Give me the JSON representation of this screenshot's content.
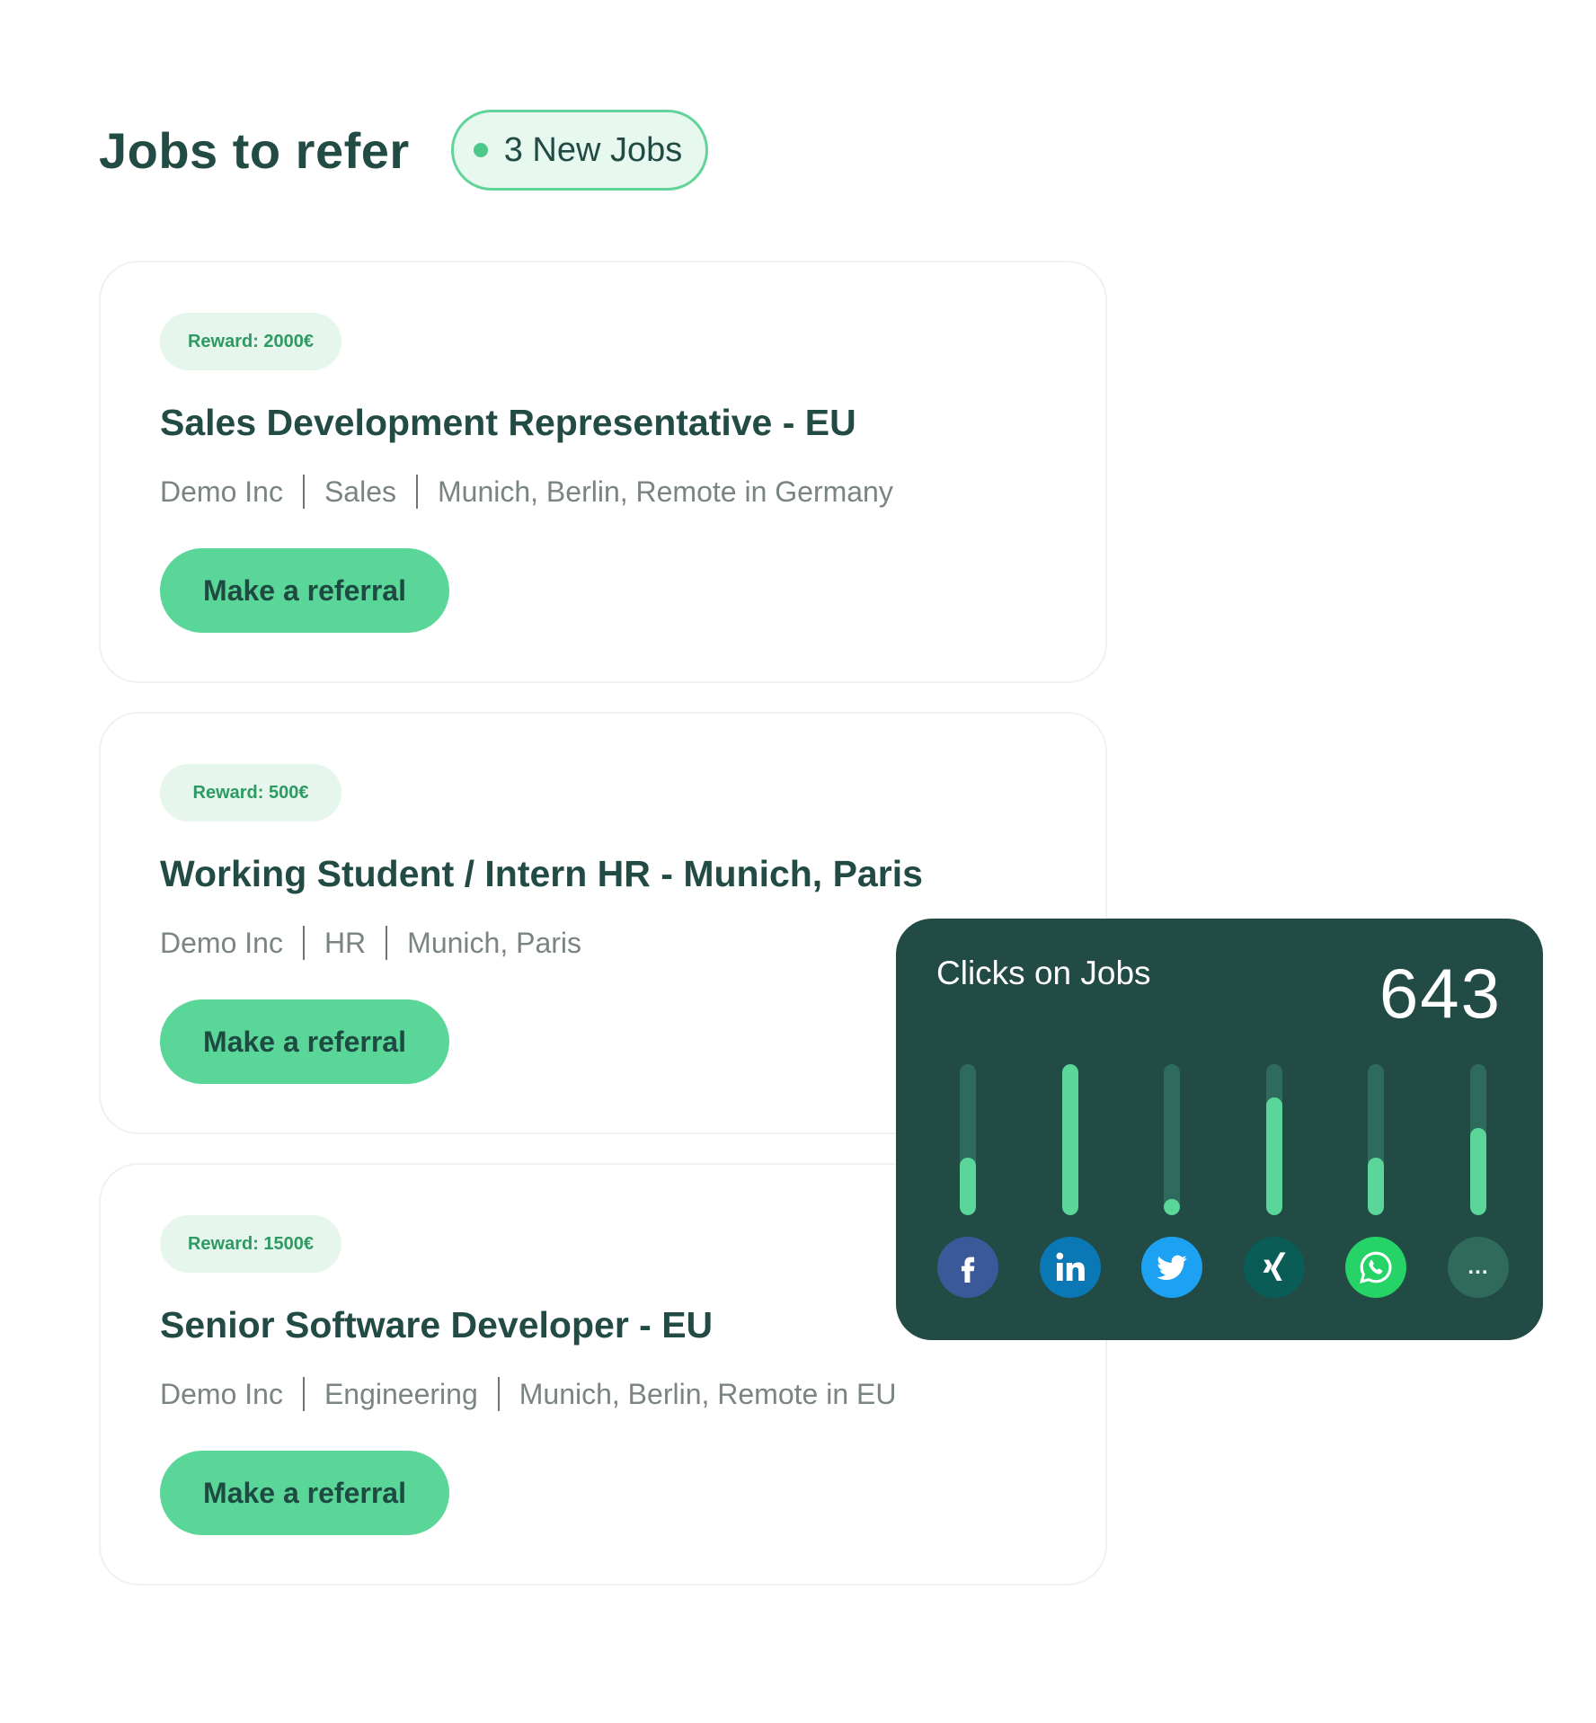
{
  "header": {
    "title": "Jobs to refer",
    "new_jobs_badge": "3 New Jobs"
  },
  "jobs": [
    {
      "reward": "Reward: 2000€",
      "title": "Sales Development Representative - EU",
      "company": "Demo Inc",
      "department": "Sales",
      "locations": "Munich, Berlin, Remote in Germany",
      "button_label": "Make a referral"
    },
    {
      "reward": "Reward: 500€",
      "title": "Working Student / Intern HR - Munich, Paris",
      "company": "Demo Inc",
      "department": "HR",
      "locations": "Munich, Paris",
      "button_label": "Make a referral"
    },
    {
      "reward": "Reward: 1500€",
      "title": "Senior Software Developer - EU",
      "company": "Demo Inc",
      "department": "Engineering",
      "locations": "Munich, Berlin, Remote in EU",
      "button_label": "Make a referral"
    }
  ],
  "stats": {
    "title": "Clicks on Jobs",
    "count": "643",
    "channels": [
      {
        "icon": "facebook-icon",
        "level": 0.38,
        "color": "#3b5998"
      },
      {
        "icon": "linkedin-icon",
        "level": 1.0,
        "color": "#0a78b5"
      },
      {
        "icon": "twitter-icon",
        "level": 0.1,
        "color": "#1da1f2"
      },
      {
        "icon": "xing-icon",
        "level": 0.78,
        "color": "#0a5c57"
      },
      {
        "icon": "whatsapp-icon",
        "level": 0.38,
        "color": "#25d366"
      },
      {
        "icon": "more-icon",
        "level": 0.58,
        "color": "#2f6a5b",
        "label": "..."
      }
    ]
  },
  "colors": {
    "brand_dark": "#214b44",
    "accent_green": "#5bd699",
    "badge_bg": "#e7f8ee"
  }
}
